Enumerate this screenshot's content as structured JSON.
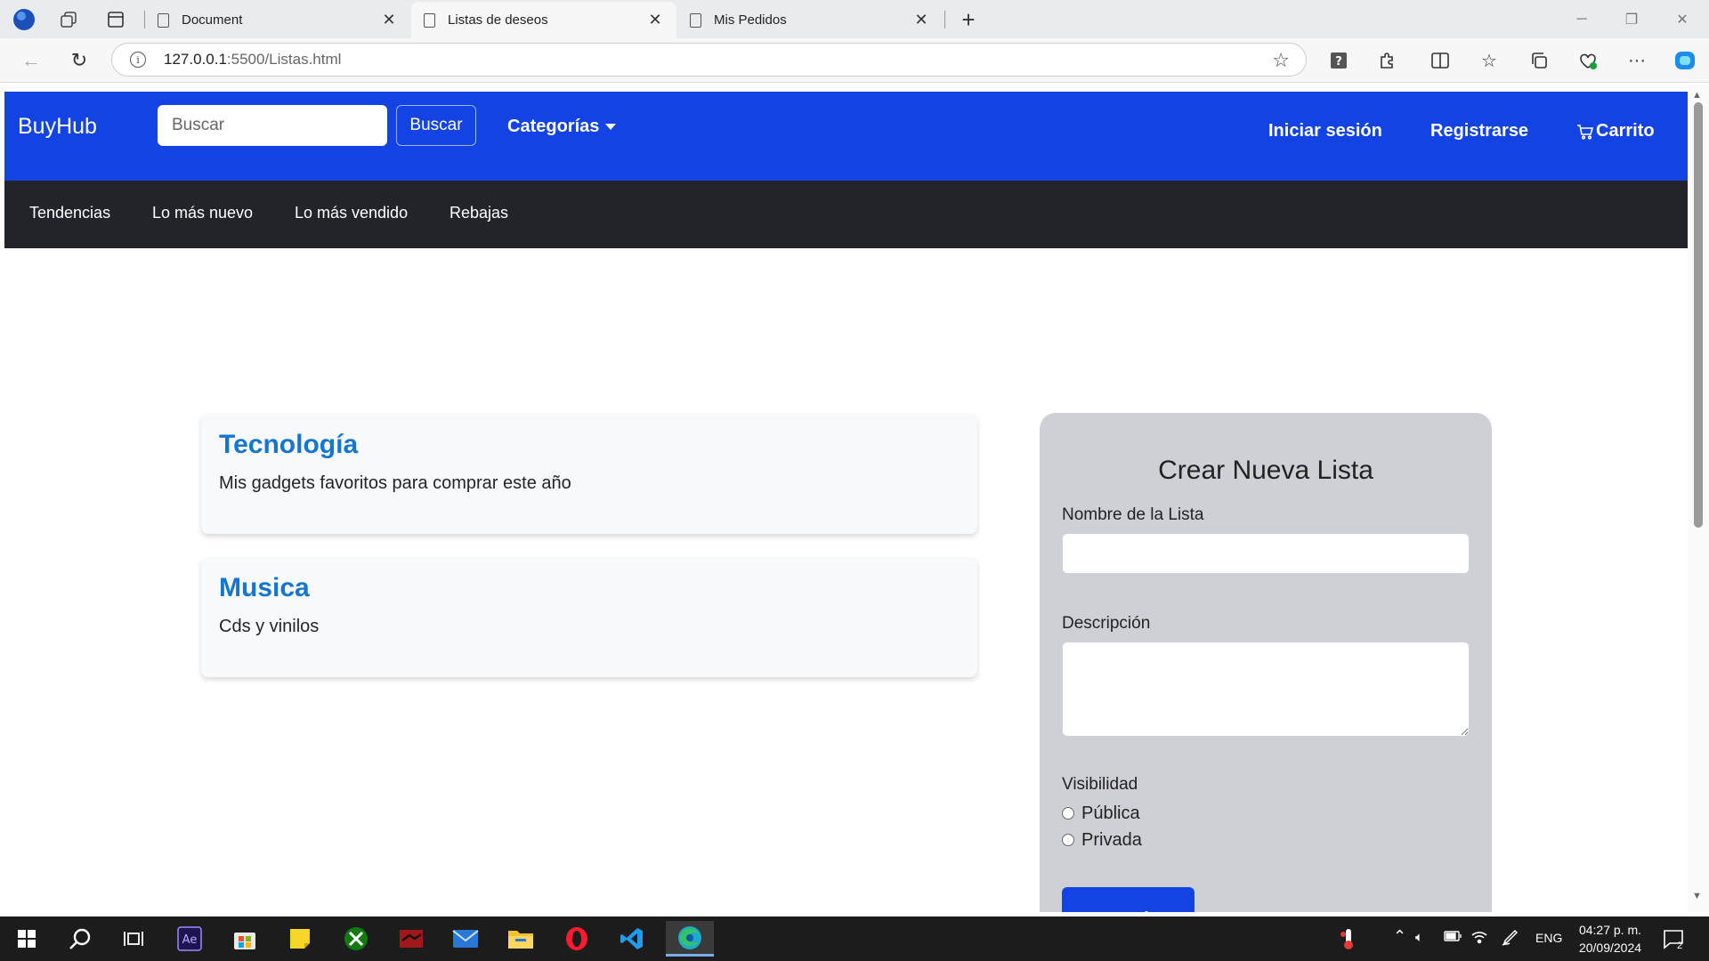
{
  "browser": {
    "tabs": [
      {
        "title": "Document"
      },
      {
        "title": "Listas de deseos"
      },
      {
        "title": "Mis Pedidos"
      }
    ],
    "new_tab": "+",
    "url_host": "127.0.0.1",
    "url_path": ":5500/Listas.html"
  },
  "navbar": {
    "brand": "BuyHub",
    "search_placeholder": "Buscar",
    "search_button": "Buscar",
    "categories": "Categorías",
    "login": "Iniciar sesión",
    "register": "Registrarse",
    "cart": "Carrito"
  },
  "subnav": {
    "links": [
      "Tendencias",
      "Lo más nuevo",
      "Lo más vendido",
      "Rebajas"
    ]
  },
  "lists": [
    {
      "title": "Tecnología",
      "description": "Mis gadgets favoritos para comprar este año"
    },
    {
      "title": "Musica",
      "description": "Cds y vinilos"
    }
  ],
  "form": {
    "title": "Crear Nueva Lista",
    "name_label": "Nombre de la Lista",
    "description_label": "Descripción",
    "visibility_label": "Visibilidad",
    "options": [
      "Pública",
      "Privada"
    ],
    "submit": "Crear Lista"
  },
  "taskbar": {
    "language": "ENG",
    "time": "04:27 p. m.",
    "date": "20/09/2024",
    "notifications": "2"
  },
  "colors": {
    "navbar": "#1443e4",
    "subnav": "#212529",
    "card_title": "#1576cf",
    "form_panel": "#ced0d6"
  }
}
